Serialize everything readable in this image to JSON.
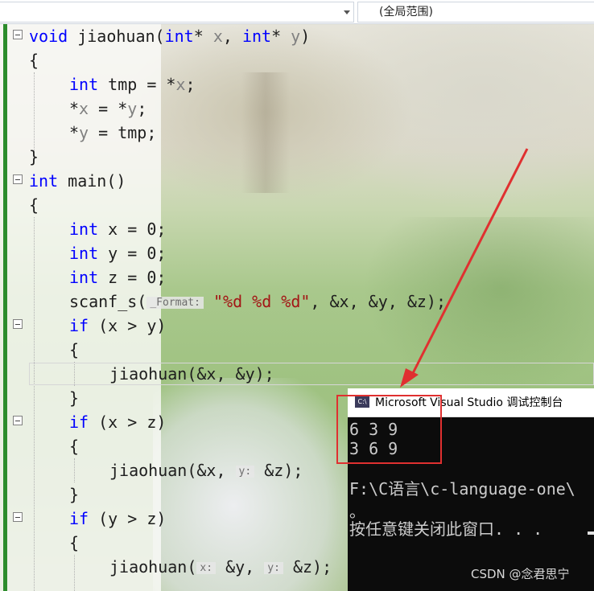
{
  "nav": {
    "left_combo_value": "",
    "right_combo_value": "(全局范围)"
  },
  "code": {
    "l1": {
      "kw1": "void",
      "name": "jiaohuan",
      "open": "(",
      "kw2": "int",
      "star1": "* ",
      "p1": "x",
      "comma": ", ",
      "kw3": "int",
      "star2": "* ",
      "p2": "y",
      "close": ")"
    },
    "l2": "{",
    "l3": {
      "kw": "int",
      "rest": " tmp = *",
      "p": "x",
      "end": ";"
    },
    "l4": {
      "a": "*",
      "p1": "x",
      "b": " = *",
      "p2": "y",
      "end": ";"
    },
    "l5": {
      "a": "*",
      "p": "y",
      "end": " = tmp;"
    },
    "l6": "}",
    "l7": {
      "kw": "int",
      "rest": " main()"
    },
    "l8": "{",
    "l9": {
      "kw": "int",
      "rest": " x = 0;"
    },
    "l10": {
      "kw": "int",
      "rest": " y = 0;"
    },
    "l11": {
      "kw": "int",
      "rest": " z = 0;"
    },
    "l12": {
      "fn": "scanf_s(",
      "hint": "_Format:",
      "str": "\"%d %d %d\"",
      "rest": ", &x, &y, &z);"
    },
    "l13": {
      "kw": "if",
      "rest": " (x > y)"
    },
    "l14": "{",
    "l15": "jiaohuan(&x, &y);",
    "l16": "}",
    "l17": {
      "kw": "if",
      "rest": " (x > z)"
    },
    "l18": "{",
    "l19": {
      "a": "jiaohuan(&x, ",
      "hint": "y:",
      "b": " &z);"
    },
    "l20": "}",
    "l21": {
      "kw": "if",
      "rest": " (y > z)"
    },
    "l22": "{",
    "l23": {
      "a": "jiaohuan(",
      "hint1": "x:",
      "b": " &y, ",
      "hint2": "y:",
      "c": " &z);"
    }
  },
  "console": {
    "icon_text": "C:\\",
    "title": "Microsoft Visual Studio 调试控制台",
    "lines": [
      "6 3 9",
      "3 6 9",
      "",
      "F:\\C语言\\c-language-one\\",
      "。",
      "按任意键关闭此窗口. . ."
    ]
  },
  "watermark": "CSDN @念君思宁",
  "colors": {
    "keyword": "#0000ff",
    "string": "#a31515",
    "annotation": "#e03030",
    "gutter_bar": "#2c8c2c"
  }
}
